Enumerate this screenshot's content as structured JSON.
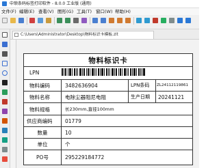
{
  "window": {
    "title": "中琅条码标签打印软件 - 8.0.0 工业版 (通用)"
  },
  "menu": [
    "文件(F)",
    "编辑(E)",
    "查看(V)",
    "图形(G)",
    "工具(T)",
    "窗口(W)",
    "帮助(H)"
  ],
  "tab": {
    "label": "C:\\Users\\Administrator\\Desktop\\物料标识卡模板.zlt"
  },
  "label": {
    "title": "物料标识卡",
    "lpn_label": "LPN",
    "rows": [
      {
        "k": "物料编码",
        "v": "3482636904",
        "k2": "LPN条码",
        "v2": "ZL24112119861"
      },
      {
        "k": "物料名称",
        "v": "电除尘器阻尼电阻",
        "k2": "生产日期",
        "v2": "20241121"
      },
      {
        "k": "物料规格",
        "v": "长230mm,直径100mm"
      },
      {
        "k": "供应商编码",
        "v": "01779"
      },
      {
        "k": "数量",
        "v": "10"
      },
      {
        "k": "单位",
        "v": "个"
      },
      {
        "k": "PO号",
        "v": "295229184772"
      }
    ]
  }
}
